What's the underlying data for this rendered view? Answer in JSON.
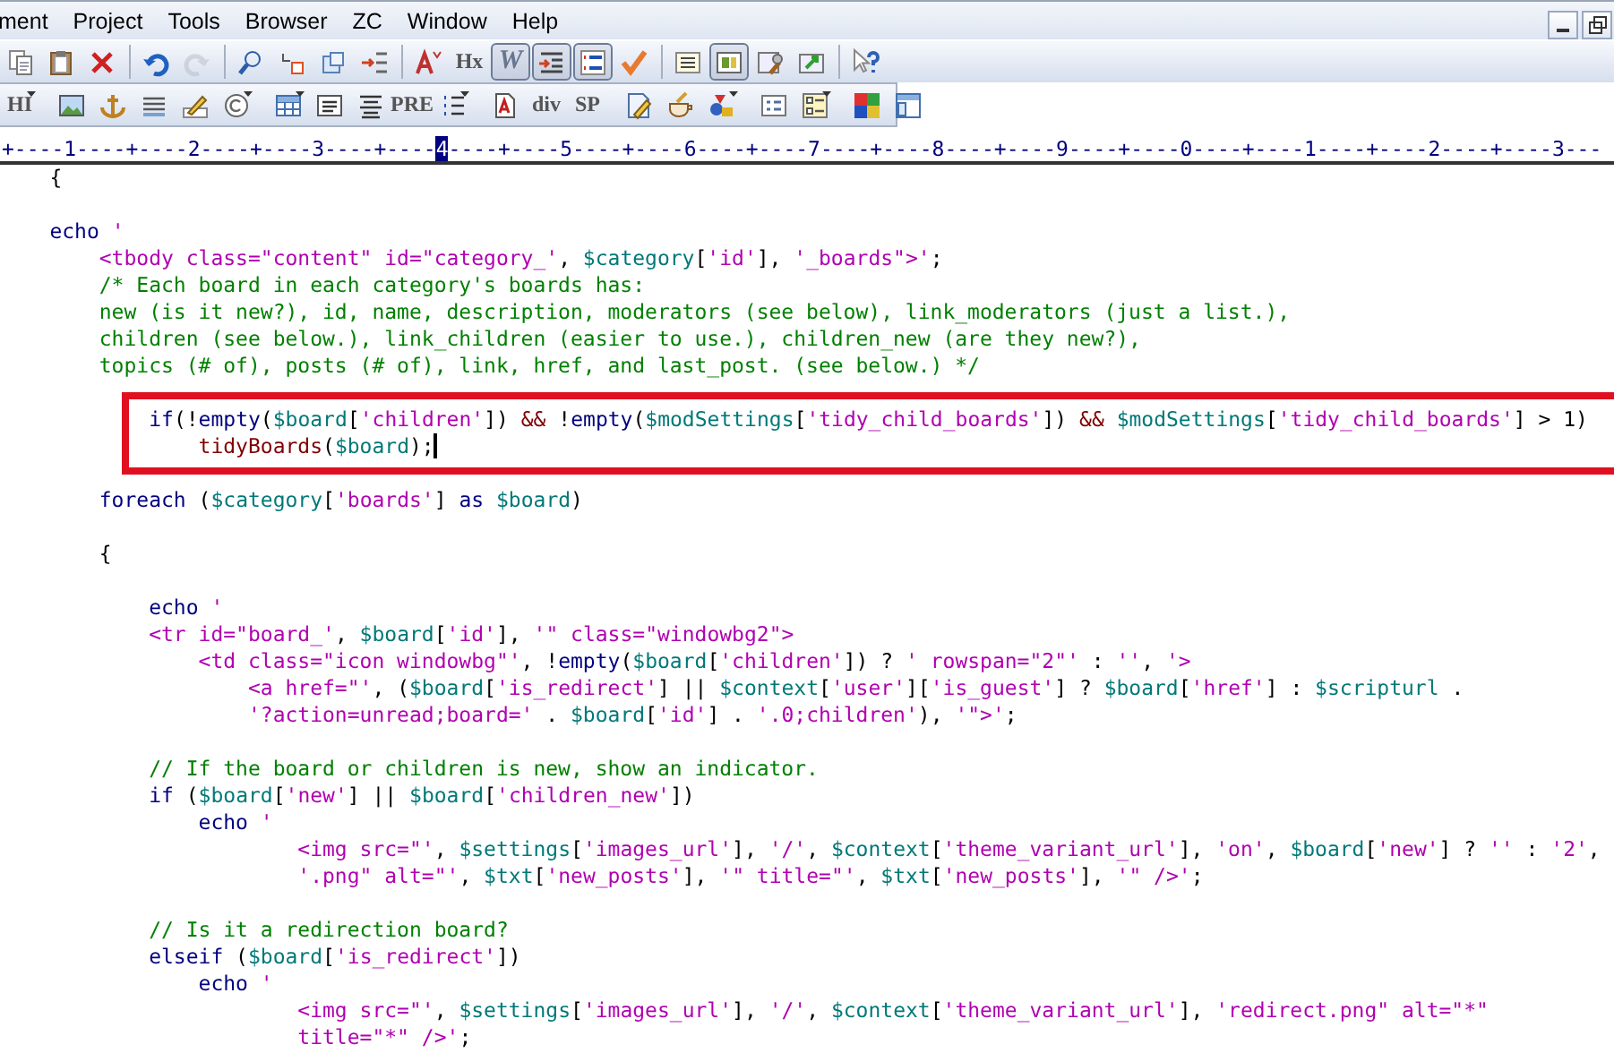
{
  "menu": [
    "ment",
    "Project",
    "Tools",
    "Browser",
    "ZC",
    "Window",
    "Help"
  ],
  "window_controls": [
    {
      "kind": "minimize"
    },
    {
      "kind": "restore"
    }
  ],
  "toolbars": [
    {
      "groups": [
        [
          {
            "kind": "copy",
            "pressed": false,
            "disabled": false,
            "dropdown": false
          },
          {
            "kind": "paste",
            "pressed": false,
            "disabled": false,
            "dropdown": false
          },
          {
            "kind": "delete",
            "pressed": false,
            "disabled": false,
            "dropdown": false
          }
        ],
        [
          {
            "kind": "undo",
            "pressed": false,
            "disabled": false,
            "dropdown": false
          },
          {
            "kind": "redo",
            "pressed": false,
            "disabled": true,
            "dropdown": false
          }
        ],
        [
          {
            "kind": "search",
            "pressed": false,
            "disabled": false,
            "dropdown": false
          },
          {
            "kind": "replace",
            "pressed": false,
            "disabled": false,
            "dropdown": false
          },
          {
            "kind": "window",
            "pressed": false,
            "disabled": false,
            "dropdown": false
          },
          {
            "kind": "numbering",
            "pressed": false,
            "disabled": false,
            "dropdown": false
          }
        ],
        [
          {
            "kind": "font-size",
            "pressed": false,
            "disabled": false,
            "dropdown": false
          },
          {
            "kind": "text",
            "label": "Hx",
            "pressed": false,
            "disabled": false,
            "dropdown": false
          },
          {
            "kind": "text",
            "label": "W",
            "pressed": true,
            "disabled": false,
            "dropdown": false
          },
          {
            "kind": "indent",
            "pressed": true,
            "disabled": false,
            "dropdown": false
          },
          {
            "kind": "numbered-list",
            "pressed": true,
            "disabled": false,
            "dropdown": false
          },
          {
            "kind": "checkmark",
            "pressed": false,
            "disabled": false,
            "dropdown": false
          }
        ],
        [
          {
            "kind": "list",
            "pressed": false,
            "disabled": false,
            "dropdown": false
          },
          {
            "kind": "layout",
            "pressed": true,
            "disabled": false,
            "dropdown": false
          },
          {
            "kind": "tools",
            "pressed": false,
            "disabled": false,
            "dropdown": false
          },
          {
            "kind": "export",
            "pressed": false,
            "disabled": false,
            "dropdown": false
          }
        ],
        [
          {
            "kind": "help",
            "pressed": false,
            "disabled": false,
            "dropdown": false
          }
        ]
      ]
    },
    {
      "groups": [
        [
          {
            "kind": "text",
            "label": "HI",
            "pressed": false,
            "disabled": false,
            "dropdown": true
          }
        ],
        [
          {
            "kind": "image",
            "pressed": false,
            "disabled": false,
            "dropdown": false
          },
          {
            "kind": "anchor",
            "pressed": false,
            "disabled": false,
            "dropdown": false
          },
          {
            "kind": "lines",
            "pressed": false,
            "disabled": false,
            "dropdown": false
          },
          {
            "kind": "pencil",
            "pressed": false,
            "disabled": false,
            "dropdown": false
          },
          {
            "kind": "copyright",
            "pressed": false,
            "disabled": false,
            "dropdown": true
          }
        ],
        [
          {
            "kind": "table",
            "pressed": false,
            "disabled": false,
            "dropdown": true
          },
          {
            "kind": "text-box",
            "pressed": false,
            "disabled": false,
            "dropdown": false
          },
          {
            "kind": "align",
            "pressed": false,
            "disabled": false,
            "dropdown": false
          },
          {
            "kind": "text",
            "label": "PRE",
            "pressed": false,
            "disabled": false,
            "dropdown": false
          },
          {
            "kind": "bullet-list",
            "pressed": false,
            "disabled": false,
            "dropdown": true
          }
        ],
        [
          {
            "kind": "document",
            "pressed": false,
            "disabled": false,
            "dropdown": false
          },
          {
            "kind": "text",
            "label": "div",
            "pressed": false,
            "disabled": false,
            "dropdown": false
          },
          {
            "kind": "text",
            "label": "SP",
            "pressed": false,
            "disabled": false,
            "dropdown": false
          }
        ],
        [
          {
            "kind": "edit-document",
            "pressed": false,
            "disabled": false,
            "dropdown": false
          },
          {
            "kind": "cup",
            "pressed": false,
            "disabled": false,
            "dropdown": false
          },
          {
            "kind": "shapes",
            "pressed": false,
            "disabled": false,
            "dropdown": true
          }
        ],
        [
          {
            "kind": "list-box",
            "pressed": false,
            "disabled": false,
            "dropdown": false
          },
          {
            "kind": "form",
            "pressed": false,
            "disabled": false,
            "dropdown": true
          }
        ],
        [
          {
            "kind": "color-grid",
            "pressed": false,
            "disabled": false,
            "dropdown": false
          },
          {
            "kind": "panel",
            "pressed": false,
            "disabled": false,
            "dropdown": false
          }
        ]
      ]
    }
  ],
  "ruler": {
    "before": "+----1----+----2----+----3----+----",
    "marker": "4",
    "after": "----+----5----+----6----+----7----+----8----+----9----+----0----+----1----+----2----+----3---"
  },
  "code": {
    "blocks": [
      {
        "highlighted": false,
        "lines": [
          [
            {
              "kind": "p",
              "text": "    {"
            }
          ]
        ]
      },
      {
        "highlighted": false,
        "lines": [
          [
            {
              "kind": "k",
              "text": "    echo "
            },
            {
              "kind": "s",
              "text": "'"
            }
          ],
          [
            {
              "kind": "s",
              "text": "        <tbody class=\"content\" id=\"category_'"
            },
            {
              "kind": "p",
              "text": ", "
            },
            {
              "kind": "v",
              "text": "$category"
            },
            {
              "kind": "p",
              "text": "["
            },
            {
              "kind": "s",
              "text": "'id'"
            },
            {
              "kind": "p",
              "text": "], "
            },
            {
              "kind": "s",
              "text": "'_boards\">'"
            },
            {
              "kind": "p",
              "text": ";"
            }
          ],
          [
            {
              "kind": "c",
              "text": "        /* Each board in each category's boards has:"
            }
          ],
          [
            {
              "kind": "c",
              "text": "        new (is it new?), id, name, description, moderators (see below), link_moderators (just a list.),"
            }
          ],
          [
            {
              "kind": "c",
              "text": "        children (see below.), link_children (easier to use.), children_new (are they new?),"
            }
          ],
          [
            {
              "kind": "c",
              "text": "        topics (# of), posts (# of), link, href, and last_post. (see below.) */"
            }
          ]
        ]
      },
      {
        "highlighted": true,
        "lines": [
          [
            {
              "kind": "k",
              "text": "            if"
            },
            {
              "kind": "p",
              "text": "(!"
            },
            {
              "kind": "k",
              "text": "empty"
            },
            {
              "kind": "p",
              "text": "("
            },
            {
              "kind": "v",
              "text": "$board"
            },
            {
              "kind": "p",
              "text": "["
            },
            {
              "kind": "s",
              "text": "'children'"
            },
            {
              "kind": "p",
              "text": "]) "
            },
            {
              "kind": "f",
              "text": "&&"
            },
            {
              "kind": "p",
              "text": " !"
            },
            {
              "kind": "k",
              "text": "empty"
            },
            {
              "kind": "p",
              "text": "("
            },
            {
              "kind": "v",
              "text": "$modSettings"
            },
            {
              "kind": "p",
              "text": "["
            },
            {
              "kind": "s",
              "text": "'tidy_child_boards'"
            },
            {
              "kind": "p",
              "text": "]) "
            },
            {
              "kind": "f",
              "text": "&& "
            },
            {
              "kind": "v",
              "text": "$modSettings"
            },
            {
              "kind": "p",
              "text": "["
            },
            {
              "kind": "s",
              "text": "'tidy_child_boards'"
            },
            {
              "kind": "p",
              "text": "] > 1)"
            }
          ],
          [
            {
              "kind": "f",
              "text": "                tidyBoards"
            },
            {
              "kind": "p",
              "text": "("
            },
            {
              "kind": "v",
              "text": "$board"
            },
            {
              "kind": "p",
              "text": ");"
            },
            {
              "kind": "caret"
            }
          ]
        ]
      },
      {
        "highlighted": false,
        "lines": [
          [
            {
              "kind": "k",
              "text": "        foreach"
            },
            {
              "kind": "p",
              "text": " ("
            },
            {
              "kind": "v",
              "text": "$category"
            },
            {
              "kind": "p",
              "text": "["
            },
            {
              "kind": "s",
              "text": "'boards'"
            },
            {
              "kind": "p",
              "text": "] "
            },
            {
              "kind": "k",
              "text": "as "
            },
            {
              "kind": "v",
              "text": "$board"
            },
            {
              "kind": "p",
              "text": ")"
            }
          ]
        ]
      },
      {
        "highlighted": false,
        "lines": [
          [
            {
              "kind": "p",
              "text": "        {"
            }
          ]
        ]
      },
      {
        "highlighted": false,
        "lines": [
          [
            {
              "kind": "k",
              "text": "            echo "
            },
            {
              "kind": "s",
              "text": "'"
            }
          ],
          [
            {
              "kind": "s",
              "text": "            <tr id=\"board_'"
            },
            {
              "kind": "p",
              "text": ", "
            },
            {
              "kind": "v",
              "text": "$board"
            },
            {
              "kind": "p",
              "text": "["
            },
            {
              "kind": "s",
              "text": "'id'"
            },
            {
              "kind": "p",
              "text": "], "
            },
            {
              "kind": "s",
              "text": "'\" class=\"windowbg2\">"
            }
          ],
          [
            {
              "kind": "s",
              "text": "                <td class=\"icon windowbg\"'"
            },
            {
              "kind": "p",
              "text": ", !"
            },
            {
              "kind": "k",
              "text": "empty"
            },
            {
              "kind": "p",
              "text": "("
            },
            {
              "kind": "v",
              "text": "$board"
            },
            {
              "kind": "p",
              "text": "["
            },
            {
              "kind": "s",
              "text": "'children'"
            },
            {
              "kind": "p",
              "text": "]) ? "
            },
            {
              "kind": "s",
              "text": "' rowspan=\"2\"'"
            },
            {
              "kind": "p",
              "text": " : "
            },
            {
              "kind": "s",
              "text": "''"
            },
            {
              "kind": "p",
              "text": ", "
            },
            {
              "kind": "s",
              "text": "'>"
            }
          ],
          [
            {
              "kind": "s",
              "text": "                    <a href=\"'"
            },
            {
              "kind": "p",
              "text": ", ("
            },
            {
              "kind": "v",
              "text": "$board"
            },
            {
              "kind": "p",
              "text": "["
            },
            {
              "kind": "s",
              "text": "'is_redirect'"
            },
            {
              "kind": "p",
              "text": "] || "
            },
            {
              "kind": "v",
              "text": "$context"
            },
            {
              "kind": "p",
              "text": "["
            },
            {
              "kind": "s",
              "text": "'user'"
            },
            {
              "kind": "p",
              "text": "]["
            },
            {
              "kind": "s",
              "text": "'is_guest'"
            },
            {
              "kind": "p",
              "text": "] ? "
            },
            {
              "kind": "v",
              "text": "$board"
            },
            {
              "kind": "p",
              "text": "["
            },
            {
              "kind": "s",
              "text": "'href'"
            },
            {
              "kind": "p",
              "text": "] : "
            },
            {
              "kind": "v",
              "text": "$scripturl"
            },
            {
              "kind": "p",
              "text": " ."
            }
          ],
          [
            {
              "kind": "s",
              "text": "                    '?action=unread;board='"
            },
            {
              "kind": "p",
              "text": " . "
            },
            {
              "kind": "v",
              "text": "$board"
            },
            {
              "kind": "p",
              "text": "["
            },
            {
              "kind": "s",
              "text": "'id'"
            },
            {
              "kind": "p",
              "text": "] . "
            },
            {
              "kind": "s",
              "text": "'.0;children'"
            },
            {
              "kind": "p",
              "text": "), "
            },
            {
              "kind": "s",
              "text": "'\">'"
            },
            {
              "kind": "p",
              "text": ";"
            }
          ]
        ]
      },
      {
        "highlighted": false,
        "lines": [
          [
            {
              "kind": "c",
              "text": "            // If the board or children is new, show an indicator."
            }
          ],
          [
            {
              "kind": "k",
              "text": "            if"
            },
            {
              "kind": "p",
              "text": " ("
            },
            {
              "kind": "v",
              "text": "$board"
            },
            {
              "kind": "p",
              "text": "["
            },
            {
              "kind": "s",
              "text": "'new'"
            },
            {
              "kind": "p",
              "text": "] || "
            },
            {
              "kind": "v",
              "text": "$board"
            },
            {
              "kind": "p",
              "text": "["
            },
            {
              "kind": "s",
              "text": "'children_new'"
            },
            {
              "kind": "p",
              "text": "])"
            }
          ],
          [
            {
              "kind": "k",
              "text": "                echo "
            },
            {
              "kind": "s",
              "text": "'"
            }
          ],
          [
            {
              "kind": "s",
              "text": "                        <img src=\"'"
            },
            {
              "kind": "p",
              "text": ", "
            },
            {
              "kind": "v",
              "text": "$settings"
            },
            {
              "kind": "p",
              "text": "["
            },
            {
              "kind": "s",
              "text": "'images_url'"
            },
            {
              "kind": "p",
              "text": "], "
            },
            {
              "kind": "s",
              "text": "'/'"
            },
            {
              "kind": "p",
              "text": ", "
            },
            {
              "kind": "v",
              "text": "$context"
            },
            {
              "kind": "p",
              "text": "["
            },
            {
              "kind": "s",
              "text": "'theme_variant_url'"
            },
            {
              "kind": "p",
              "text": "], "
            },
            {
              "kind": "s",
              "text": "'on'"
            },
            {
              "kind": "p",
              "text": ", "
            },
            {
              "kind": "v",
              "text": "$board"
            },
            {
              "kind": "p",
              "text": "["
            },
            {
              "kind": "s",
              "text": "'new'"
            },
            {
              "kind": "p",
              "text": "] ? "
            },
            {
              "kind": "s",
              "text": "''"
            },
            {
              "kind": "p",
              "text": " : "
            },
            {
              "kind": "s",
              "text": "'2'"
            },
            {
              "kind": "p",
              "text": ","
            }
          ],
          [
            {
              "kind": "s",
              "text": "                        '.png\" alt=\"'"
            },
            {
              "kind": "p",
              "text": ", "
            },
            {
              "kind": "v",
              "text": "$txt"
            },
            {
              "kind": "p",
              "text": "["
            },
            {
              "kind": "s",
              "text": "'new_posts'"
            },
            {
              "kind": "p",
              "text": "], "
            },
            {
              "kind": "s",
              "text": "'\" title=\"'"
            },
            {
              "kind": "p",
              "text": ", "
            },
            {
              "kind": "v",
              "text": "$txt"
            },
            {
              "kind": "p",
              "text": "["
            },
            {
              "kind": "s",
              "text": "'new_posts'"
            },
            {
              "kind": "p",
              "text": "], "
            },
            {
              "kind": "s",
              "text": "'\" />'"
            },
            {
              "kind": "p",
              "text": ";"
            }
          ]
        ]
      },
      {
        "highlighted": false,
        "lines": [
          [
            {
              "kind": "c",
              "text": "            // Is it a redirection board?"
            }
          ],
          [
            {
              "kind": "k",
              "text": "            elseif"
            },
            {
              "kind": "p",
              "text": " ("
            },
            {
              "kind": "v",
              "text": "$board"
            },
            {
              "kind": "p",
              "text": "["
            },
            {
              "kind": "s",
              "text": "'is_redirect'"
            },
            {
              "kind": "p",
              "text": "])"
            }
          ],
          [
            {
              "kind": "k",
              "text": "                echo "
            },
            {
              "kind": "s",
              "text": "'"
            }
          ],
          [
            {
              "kind": "s",
              "text": "                        <img src=\"'"
            },
            {
              "kind": "p",
              "text": ", "
            },
            {
              "kind": "v",
              "text": "$settings"
            },
            {
              "kind": "p",
              "text": "["
            },
            {
              "kind": "s",
              "text": "'images_url'"
            },
            {
              "kind": "p",
              "text": "], "
            },
            {
              "kind": "s",
              "text": "'/'"
            },
            {
              "kind": "p",
              "text": ", "
            },
            {
              "kind": "v",
              "text": "$context"
            },
            {
              "kind": "p",
              "text": "["
            },
            {
              "kind": "s",
              "text": "'theme_variant_url'"
            },
            {
              "kind": "p",
              "text": "], "
            },
            {
              "kind": "s",
              "text": "'redirect.png\" alt=\"*\""
            }
          ],
          [
            {
              "kind": "s",
              "text": "                        title=\"*\" />'"
            },
            {
              "kind": "p",
              "text": ";"
            }
          ]
        ]
      }
    ]
  }
}
